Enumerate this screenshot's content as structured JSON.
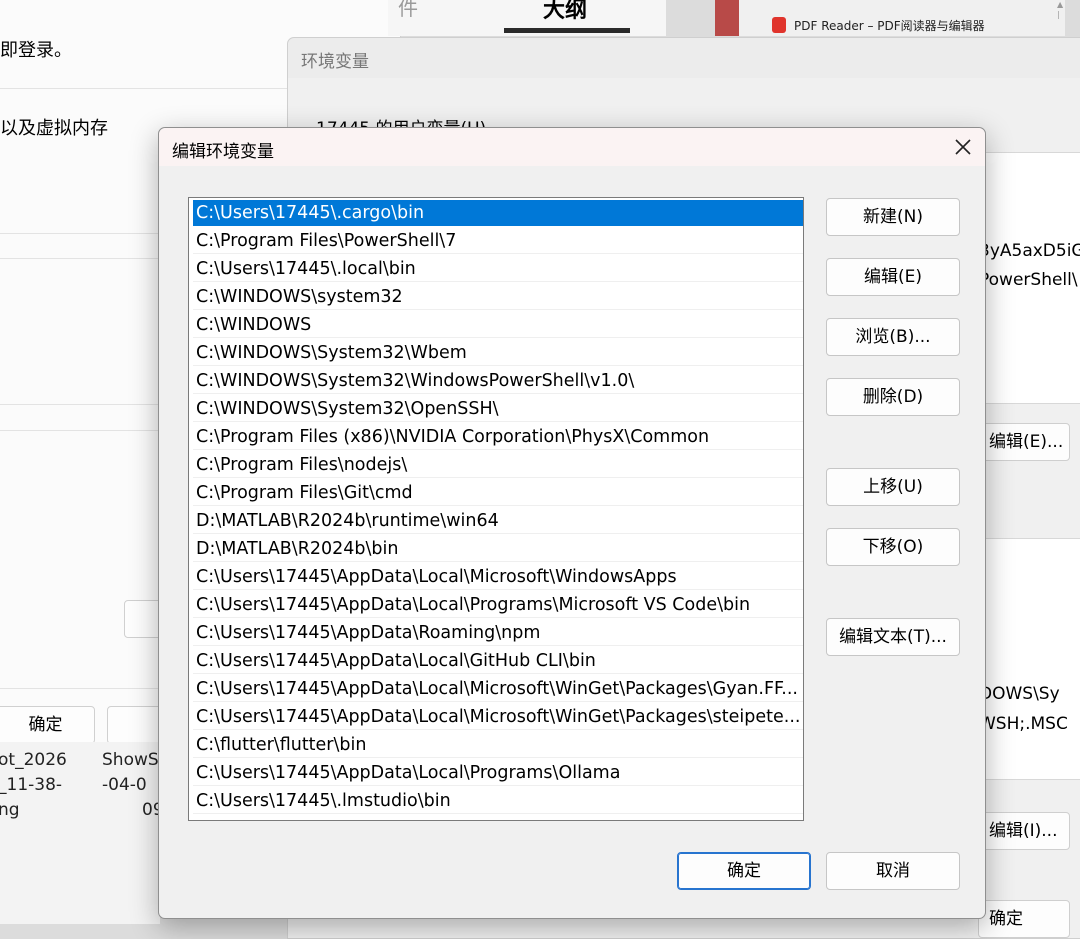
{
  "background_system": {
    "text1": "即登录。",
    "text2": "以及虚拟内存",
    "ok_button": "确定"
  },
  "background_files": {
    "name1": [
      "ot_2026",
      "_11-38-",
      "ng"
    ],
    "name2": [
      "ShowS",
      "-04-0",
      "09"
    ]
  },
  "background_tabs": {
    "tab1": "件",
    "tab2": "大纲"
  },
  "background_pdf": {
    "title": "PDF Reader – PDF阅读器与编辑器"
  },
  "env_window": {
    "title": "环境变量",
    "user_vars_label": "17445 的用户变量(U)",
    "peek_values": [
      "3yA5axD5iG",
      "PowerShell\\",
      "DOWS\\Sy",
      "WSH;.MSC"
    ],
    "edit_button": "编辑(E)...",
    "edit_button2": "编辑(I)...",
    "ok_button": "确定"
  },
  "dialog": {
    "title": "编辑环境变量",
    "selected_index": 0,
    "paths": [
      "C:\\Users\\17445\\.cargo\\bin",
      "C:\\Program Files\\PowerShell\\7",
      "C:\\Users\\17445\\.local\\bin",
      "C:\\WINDOWS\\system32",
      "C:\\WINDOWS",
      "C:\\WINDOWS\\System32\\Wbem",
      "C:\\WINDOWS\\System32\\WindowsPowerShell\\v1.0\\",
      "C:\\WINDOWS\\System32\\OpenSSH\\",
      "C:\\Program Files (x86)\\NVIDIA Corporation\\PhysX\\Common",
      "C:\\Program Files\\nodejs\\",
      "C:\\Program Files\\Git\\cmd",
      "D:\\MATLAB\\R2024b\\runtime\\win64",
      "D:\\MATLAB\\R2024b\\bin",
      "C:\\Users\\17445\\AppData\\Local\\Microsoft\\WindowsApps",
      "C:\\Users\\17445\\AppData\\Local\\Programs\\Microsoft VS Code\\bin",
      "C:\\Users\\17445\\AppData\\Roaming\\npm",
      "C:\\Users\\17445\\AppData\\Local\\GitHub CLI\\bin",
      "C:\\Users\\17445\\AppData\\Local\\Microsoft\\WinGet\\Packages\\Gyan.FF...",
      "C:\\Users\\17445\\AppData\\Local\\Microsoft\\WinGet\\Packages\\steipete...",
      "C:\\flutter\\flutter\\bin",
      "C:\\Users\\17445\\AppData\\Local\\Programs\\Ollama",
      "C:\\Users\\17445\\.lmstudio\\bin"
    ],
    "buttons": {
      "new": "新建(N)",
      "edit": "编辑(E)",
      "browse": "浏览(B)...",
      "delete": "删除(D)",
      "move_up": "上移(U)",
      "move_down": "下移(O)",
      "edit_text": "编辑文本(T)...",
      "ok": "确定",
      "cancel": "取消"
    },
    "colors": {
      "selection": "#0078d7",
      "ok_border": "#2774cf"
    }
  }
}
